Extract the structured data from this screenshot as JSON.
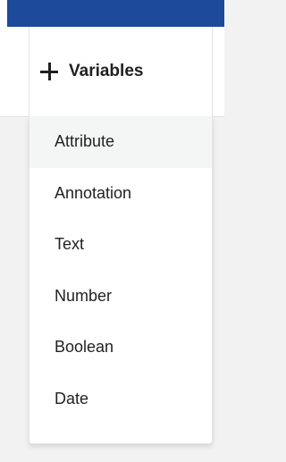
{
  "variables_button": {
    "icon": "plus-icon",
    "label": "Variables"
  },
  "menu": {
    "items": [
      {
        "label": "Attribute",
        "highlighted": true
      },
      {
        "label": "Annotation"
      },
      {
        "label": "Text"
      },
      {
        "label": "Number"
      },
      {
        "label": "Boolean"
      },
      {
        "label": "Date"
      }
    ]
  },
  "colors": {
    "top_bar": "#1e4a9c",
    "highlight": "#f4f6f5",
    "background": "#f2f2f2"
  }
}
